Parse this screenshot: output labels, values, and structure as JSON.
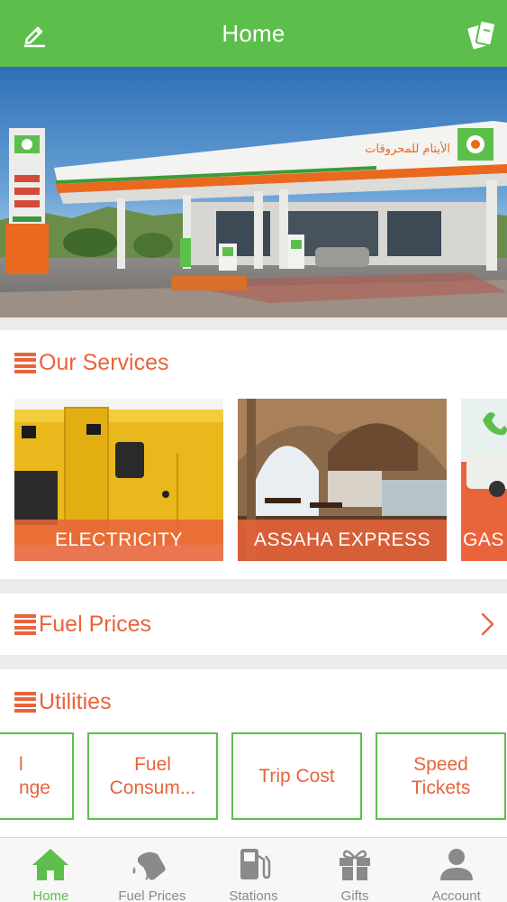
{
  "header": {
    "title": "Home",
    "left_icon": "edit-icon",
    "right_icon": "cards-icon"
  },
  "hero": {
    "station_sign_text": "الأيتام للمحروقات",
    "alt": "fuel station"
  },
  "services": {
    "title": "Our Services",
    "items": [
      {
        "label": "ELECTRICITY"
      },
      {
        "label": "ASSAHA EXPRESS"
      },
      {
        "label": "GAS"
      }
    ]
  },
  "fuel_prices": {
    "title": "Fuel Prices"
  },
  "utilities": {
    "title": "Utilities",
    "tiles": [
      {
        "line1": "l",
        "line2": "nge"
      },
      {
        "line1": "Fuel",
        "line2": "Consum..."
      },
      {
        "line1": "Trip Cost",
        "line2": ""
      },
      {
        "line1": "Speed",
        "line2": "Tickets"
      }
    ]
  },
  "nav": {
    "items": [
      {
        "label": "Home",
        "icon": "home-icon",
        "active": true
      },
      {
        "label": "Fuel Prices",
        "icon": "fuel-nozzle-icon",
        "active": false
      },
      {
        "label": "Stations",
        "icon": "gas-pump-icon",
        "active": false
      },
      {
        "label": "Gifts",
        "icon": "gift-icon",
        "active": false
      },
      {
        "label": "Account",
        "icon": "person-icon",
        "active": false
      }
    ]
  },
  "colors": {
    "green": "#5cbf4c",
    "orange": "#e8643a",
    "inactive": "#8a8a8a"
  }
}
